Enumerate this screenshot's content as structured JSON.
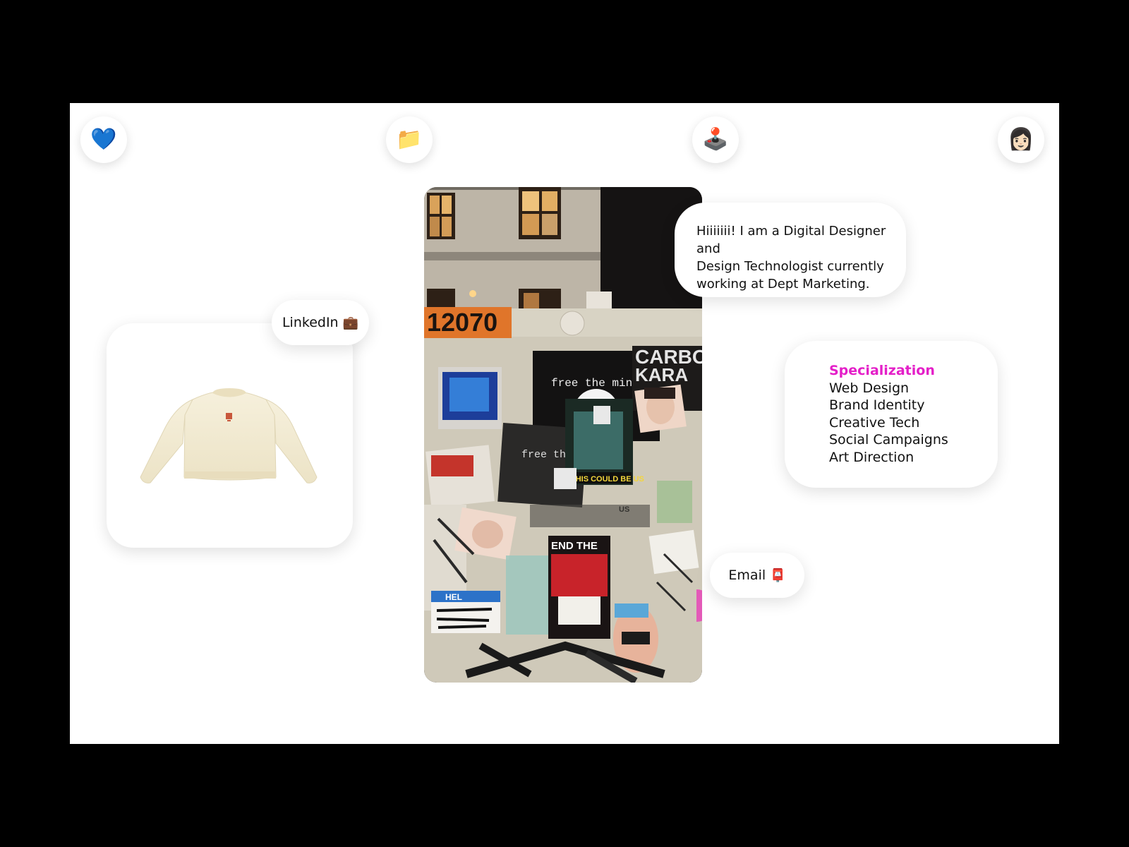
{
  "nav": [
    {
      "id": "favorites",
      "icon": "blue-heart-icon",
      "glyph": "💙"
    },
    {
      "id": "projects",
      "icon": "folder-icon",
      "glyph": "📁"
    },
    {
      "id": "games",
      "icon": "joystick-icon",
      "glyph": "🕹️"
    },
    {
      "id": "about",
      "icon": "avatar-icon",
      "glyph": "👩🏻"
    }
  ],
  "intro": {
    "lines": [
      "Hiiiiiii! I am a Digital Designer and",
      "Design Technologist currently",
      "working at Dept Marketing."
    ]
  },
  "specialization": {
    "heading": "Specialization",
    "items": [
      "Web Design",
      "Brand Identity",
      "Creative Tech",
      "Social Campaigns",
      "Art Direction"
    ],
    "accent_color": "#e41fc8"
  },
  "linkedin": {
    "label": "LinkedIn",
    "icon": "briefcase-icon",
    "glyph": "💼"
  },
  "email": {
    "label": "Email",
    "icon": "mailbox-icon",
    "glyph": "📮"
  },
  "photo": {
    "number_sticker": "12070",
    "sticker_free_mind": "free the mind",
    "sticker_free_the": "free the",
    "sticker_could_be_us": "THIS COULD BE US",
    "sticker_end_the": "END THE",
    "sticker_hello": "HEL",
    "sticker_us": "US",
    "sticker_carbo": "CARBO",
    "sticker_kara": "KARA"
  }
}
